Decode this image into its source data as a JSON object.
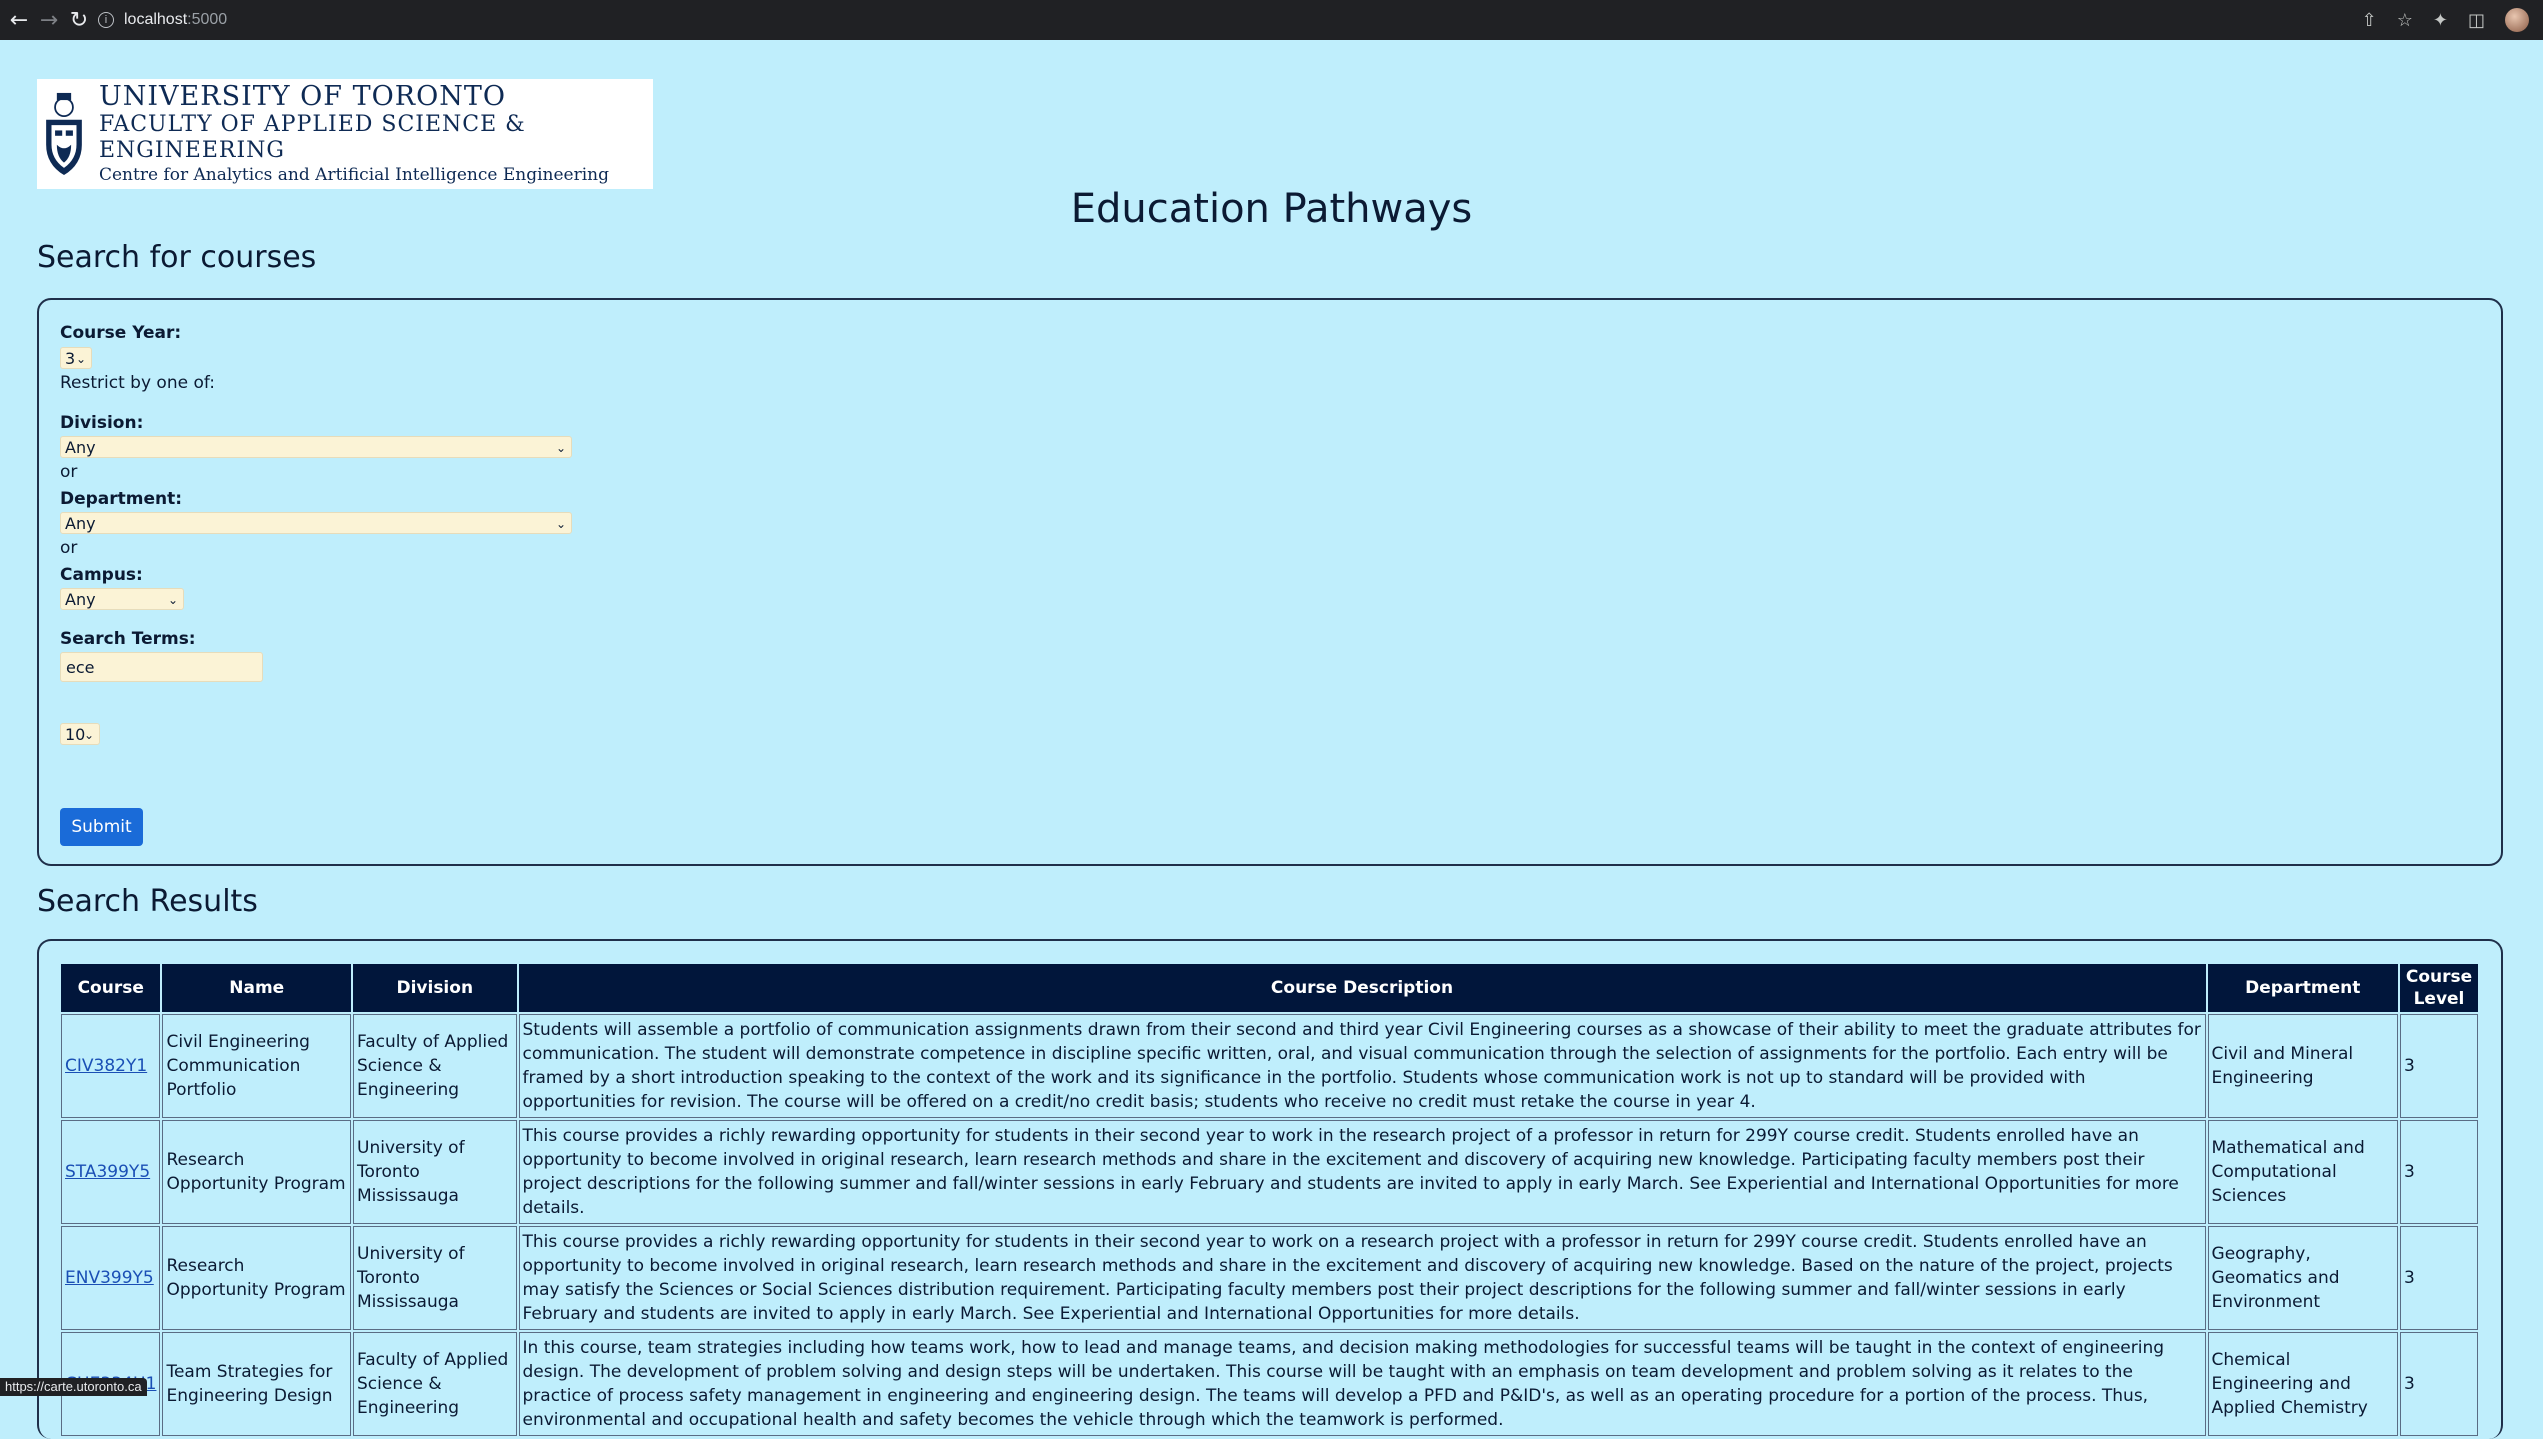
{
  "browser": {
    "url_host": "localhost",
    "url_port": ":5000",
    "status_url": "https://carte.utoronto.ca"
  },
  "logo": {
    "line1": "UNIVERSITY OF TORONTO",
    "line2": "FACULTY OF APPLIED SCIENCE & ENGINEERING",
    "line3": "Centre for Analytics and Artificial Intelligence Engineering"
  },
  "page_title": "Education Pathways",
  "search": {
    "heading": "Search for courses",
    "course_year_label": "Course Year:",
    "course_year_value": "3",
    "restrict_text": "Restrict by one of:",
    "division_label": "Division:",
    "division_value": "Any",
    "or_1": "or",
    "department_label": "Department:",
    "department_value": "Any",
    "or_2": "or",
    "campus_label": "Campus:",
    "campus_value": "Any",
    "terms_label": "Search Terms:",
    "terms_value": "ece",
    "limit_value": "10",
    "submit_label": "Submit"
  },
  "results": {
    "heading": "Search Results",
    "columns": [
      "Course",
      "Name",
      "Division",
      "Course Description",
      "Department",
      "Course Level"
    ],
    "rows": [
      {
        "code": "CIV382Y1",
        "name": "Civil Engineering Communication Portfolio",
        "division": "Faculty of Applied Science & Engineering",
        "description": "Students will assemble a portfolio of communication assignments drawn from their second and third year Civil Engineering courses as a showcase of their ability to meet the graduate attributes for communication. The student will demonstrate competence in discipline specific written, oral, and visual communication through the selection of assignments for the portfolio. Each entry will be framed by a short introduction speaking to the context of the work and its significance in the portfolio. Students whose communication work is not up to standard will be provided with opportunities for revision. The course will be offered on a credit/no credit basis; students who receive no credit must retake the course in year 4.",
        "department": "Civil and Mineral Engineering",
        "level": "3"
      },
      {
        "code": "STA399Y5",
        "name": "Research Opportunity Program",
        "division": "University of Toronto Mississauga",
        "description": "This course provides a richly rewarding opportunity for students in their second year to work in the research project of a professor in return for 299Y course credit. Students enrolled have an opportunity to become involved in original research, learn research methods and share in the excitement and discovery of acquiring new knowledge. Participating faculty members post their project descriptions for the following summer and fall/winter sessions in early February and students are invited to apply in early March. See Experiential and International Opportunities for more details.",
        "department": "Mathematical and Computational Sciences",
        "level": "3"
      },
      {
        "code": "ENV399Y5",
        "name": "Research Opportunity Program",
        "division": "University of Toronto Mississauga",
        "description": "This course provides a richly rewarding opportunity for students in their second year to work on a research project with a professor in return for 299Y course credit. Students enrolled have an opportunity to become involved in original research, learn research methods and share in the excitement and discovery of acquiring new knowledge. Based on the nature of the project, projects may satisfy the Sciences or Social Sciences distribution requirement. Participating faculty members post their project descriptions for the following summer and fall/winter sessions in early February and students are invited to apply in early March. See Experiential and International Opportunities for more details.",
        "department": "Geography, Geomatics and Environment",
        "level": "3"
      },
      {
        "code": "CHE334H1",
        "name": "Team Strategies for Engineering Design",
        "division": "Faculty of Applied Science & Engineering",
        "description": "In this course, team strategies including how teams work, how to lead and manage teams, and decision making methodologies for successful teams will be taught in the context of engineering design. The development of problem solving and design steps will be undertaken. This course will be taught with an emphasis on team development and problem solving as it relates to the practice of process safety management in engineering and engineering design. The teams will develop a PFD and P&ID's, as well as an operating procedure for a portion of the process. Thus, environmental and occupational health and safety becomes the vehicle through which the teamwork is performed.",
        "department": "Chemical Engineering and Applied Chemistry",
        "level": "3"
      }
    ]
  }
}
